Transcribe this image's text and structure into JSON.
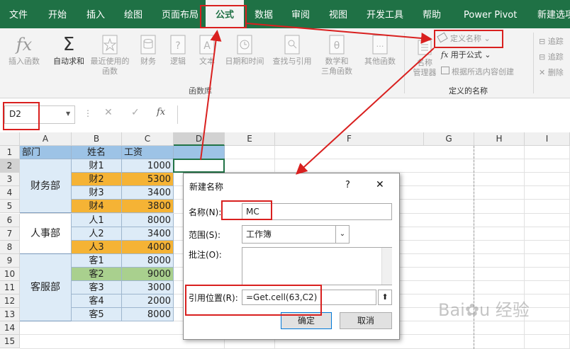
{
  "tabs": [
    "文件",
    "开始",
    "插入",
    "绘图",
    "页面布局",
    "公式",
    "数据",
    "审阅",
    "视图",
    "开发工具",
    "帮助",
    "Power Pivot",
    "新建选项"
  ],
  "ribbon": {
    "insert_function": "插入函数",
    "autosum": "自动求和",
    "recent_line1": "最近使用的",
    "recent_line2": "函数",
    "financial": "财务",
    "logical": "逻辑",
    "text": "文本",
    "datetime": "日期和时间",
    "lookup": "查找与引用",
    "math_line1": "数学和",
    "math_line2": "三角函数",
    "other": "其他函数",
    "group_library": "函数库",
    "name_manager_line1": "名称",
    "name_manager_line2": "管理器",
    "define_name": "定义名称",
    "use_in_formula": "用于公式",
    "create_from_selection": "根据所选内容创建",
    "group_defined_names": "定义的名称",
    "trace_precedents": "追踪",
    "trace_dependents": "追踪",
    "remove_arrows": "删除"
  },
  "formula_bar": {
    "name_box": "D2",
    "fx": "fx",
    "formula": ""
  },
  "sheet": {
    "col_headers": [
      "A",
      "B",
      "C",
      "D",
      "E",
      "F",
      "G",
      "H",
      "I"
    ],
    "row_headers": [
      "1",
      "2",
      "3",
      "4",
      "5",
      "6",
      "7",
      "8",
      "9",
      "10",
      "11",
      "12",
      "13",
      "14",
      "15"
    ],
    "header_row": [
      "部门",
      "姓名",
      "工资"
    ],
    "departments": [
      "财务部",
      "人事部",
      "客服部"
    ],
    "rows": [
      {
        "name": "财1",
        "salary": "1000",
        "highlight": "none"
      },
      {
        "name": "财2",
        "salary": "5300",
        "highlight": "orange"
      },
      {
        "name": "财3",
        "salary": "3400",
        "highlight": "none"
      },
      {
        "name": "财4",
        "salary": "3800",
        "highlight": "orange"
      },
      {
        "name": "人1",
        "salary": "8000",
        "highlight": "none"
      },
      {
        "name": "人2",
        "salary": "3400",
        "highlight": "none"
      },
      {
        "name": "人3",
        "salary": "4000",
        "highlight": "orange"
      },
      {
        "name": "客1",
        "salary": "8000",
        "highlight": "none"
      },
      {
        "name": "客2",
        "salary": "9000",
        "highlight": "green"
      },
      {
        "name": "客3",
        "salary": "3000",
        "highlight": "none"
      },
      {
        "name": "客4",
        "salary": "2000",
        "highlight": "none"
      },
      {
        "name": "客5",
        "salary": "8000",
        "highlight": "none"
      }
    ]
  },
  "colors": {
    "header_blue": "#9dc3e6",
    "pale_blue": "#ddebf7",
    "orange": "#f5b335",
    "green": "#a9d08e",
    "ribbon_green": "#1f7145",
    "annotation_red": "#d9201f"
  },
  "dialog": {
    "title": "新建名称",
    "help": "?",
    "close": "✕",
    "name_label": "名称(N):",
    "name_value": "MC",
    "scope_label": "范围(S):",
    "scope_value": "工作簿",
    "comment_label": "批注(O):",
    "comment_value": "",
    "refers_label": "引用位置(R):",
    "refers_value": "=Get.cell(63,C2)",
    "ok": "确定",
    "cancel": "取消"
  }
}
